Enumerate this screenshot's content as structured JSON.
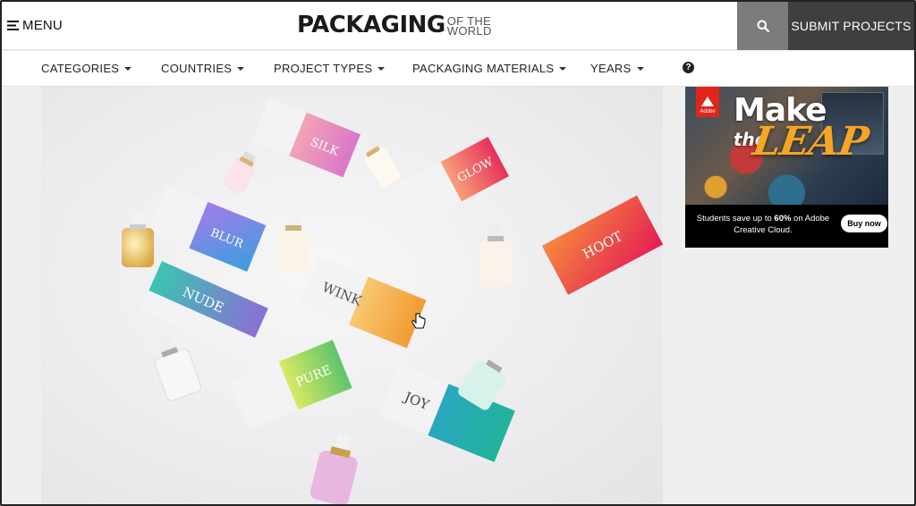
{
  "header": {
    "menu_label": "MENU",
    "logo_main": "PACKAGING",
    "logo_sub_line1": "OF THE",
    "logo_sub_line2": "WORLD",
    "search_icon": "search-icon",
    "submit_label": "SUBMIT PROJECTS"
  },
  "nav": {
    "items": [
      {
        "label": "CATEGORIES"
      },
      {
        "label": "COUNTRIES"
      },
      {
        "label": "PROJECT TYPES"
      },
      {
        "label": "PACKAGING MATERIALS"
      },
      {
        "label": "YEARS"
      }
    ],
    "help_icon": "question-circle-icon"
  },
  "hero": {
    "labels": {
      "silk": "SILK",
      "glow": "GLOW",
      "blur": "BLUR",
      "wink": "WINK",
      "hoot": "HOOT",
      "nude": "NUDE",
      "pure": "PURE",
      "joy": "JOY"
    }
  },
  "ad": {
    "brand": "Adobe",
    "headline_1": "Make",
    "headline_2": "the",
    "headline_3": "LEAP",
    "copy_prefix": "Students save up to ",
    "copy_bold": "60%",
    "copy_suffix": " on Adobe Creative Cloud.",
    "button": "Buy now"
  },
  "colors": {
    "search_bg": "#7c7c7c",
    "submit_bg": "#3f3f3f",
    "adobe_red": "#e1251b",
    "leap_orange": "#f5a623"
  }
}
